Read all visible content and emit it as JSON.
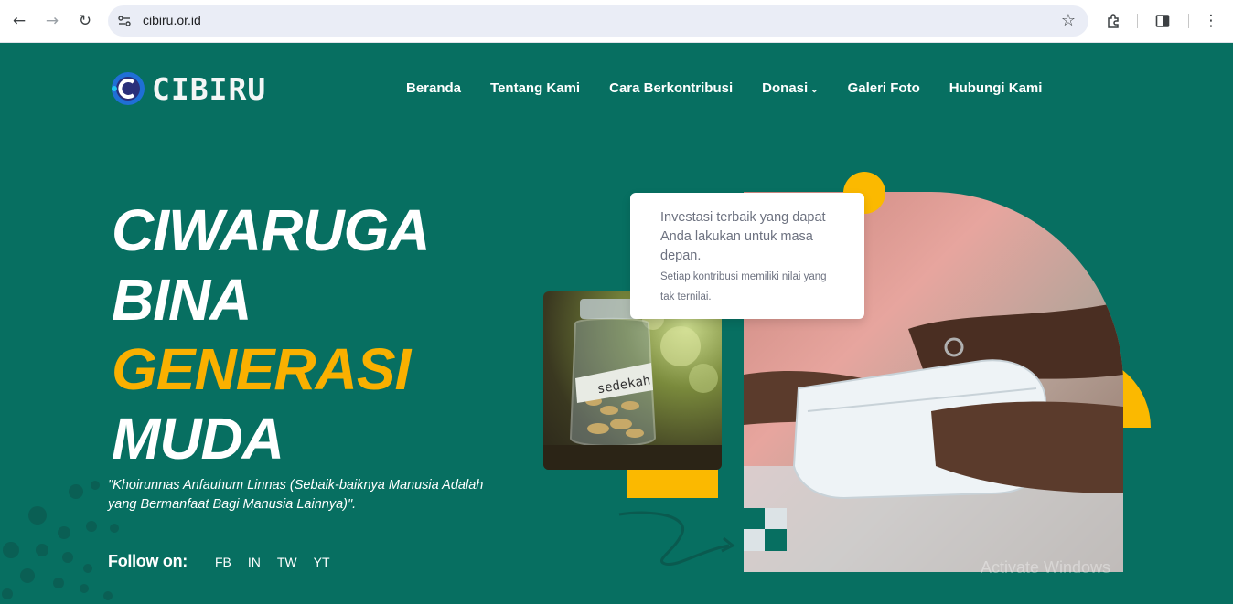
{
  "browser": {
    "url": "cibiru.or.id"
  },
  "site": {
    "logo_text": "CIBIRU",
    "nav": [
      {
        "label": "Beranda"
      },
      {
        "label": "Tentang Kami"
      },
      {
        "label": "Cara Berkontribusi"
      },
      {
        "label": "Donasi"
      },
      {
        "label": "Galeri Foto"
      },
      {
        "label": "Hubungi Kami"
      }
    ],
    "nav_dropdown_chevron": "⌄"
  },
  "hero": {
    "title_line1": "CIWARUGA",
    "title_line2": "BINA",
    "title_line3": "GENERASI",
    "title_line4": "MUDA",
    "quote": "\"Khoirunnas Anfauhum Linnas (Sebaik-baiknya Manusia Adalah yang Bermanfaat Bagi Manusia Lainnya)\".",
    "follow_label": "Follow on:",
    "social": [
      "FB",
      "IN",
      "TW",
      "YT"
    ]
  },
  "card": {
    "main_text": "Investasi terbaik yang dapat Anda lakukan untuk masa depan.",
    "sub_text": "Setiap kontribusi memiliki nilai yang tak ternilai."
  },
  "jar_label": "sedekah",
  "watermark": "Activate Windows",
  "colors": {
    "background": "#076f61",
    "accent": "#f9b000",
    "text": "#ffffff"
  }
}
